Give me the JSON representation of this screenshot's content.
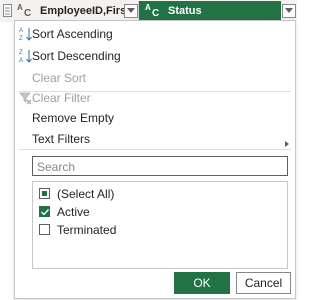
{
  "header": {
    "columns": [
      {
        "type_symbol": "ABC",
        "title": "EmployeeID,FirstNa..."
      },
      {
        "type_symbol": "ABC",
        "title": "Status"
      }
    ],
    "accent": "#217346"
  },
  "menu": {
    "items": [
      {
        "label": "Sort Ascending",
        "icon": "sort-ascending-icon",
        "enabled": true
      },
      {
        "label": "Sort Descending",
        "icon": "sort-descending-icon",
        "enabled": true
      },
      {
        "label": "Clear Sort",
        "enabled": false
      },
      {
        "label": "Clear Filter",
        "icon": "clear-filter-icon",
        "enabled": false
      },
      {
        "label": "Remove Empty",
        "enabled": true
      },
      {
        "label": "Text Filters",
        "has_submenu": true,
        "enabled": true
      }
    ]
  },
  "search": {
    "placeholder": "Search"
  },
  "values": {
    "items": [
      {
        "label": "(Select All)",
        "state": "partial"
      },
      {
        "label": "Active",
        "state": "checked"
      },
      {
        "label": "Terminated",
        "state": "unchecked"
      }
    ]
  },
  "buttons": {
    "ok": "OK",
    "cancel": "Cancel"
  }
}
